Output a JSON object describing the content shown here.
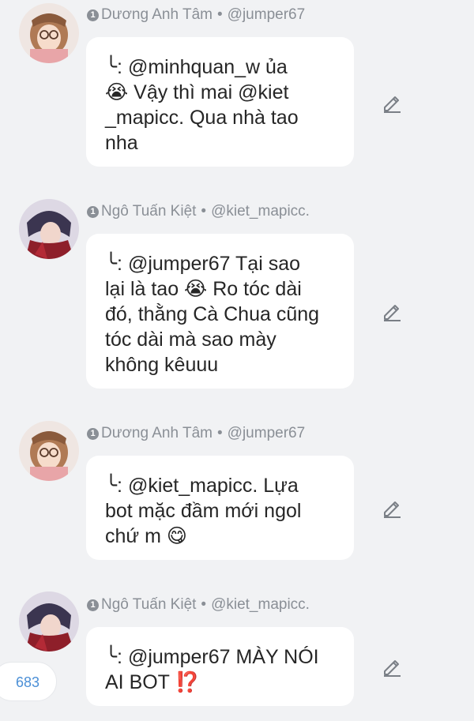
{
  "posts": [
    {
      "author": "Dương Anh Tâm",
      "handle": "@jumper67",
      "badge": "1",
      "avatar": "avatar-girl-glasses",
      "message": "╰: @minhquan_w ủa\n😭 Vậy thì mai @kiet\n_mapicc. Qua nhà tao\nnha"
    },
    {
      "author": "Ngô Tuấn Kiệt",
      "handle": "@kiet_mapicc.",
      "badge": "1",
      "avatar": "avatar-boy-red",
      "message": "╰: @jumper67 Tại sao\nlại là tao 😭 Ro tóc dài\nđó, thằng Cà Chua cũng\ntóc dài mà sao mày\nkhông kêuuu"
    },
    {
      "author": "Dương Anh Tâm",
      "handle": "@jumper67",
      "badge": "1",
      "avatar": "avatar-girl-glasses",
      "message": "╰: @kiet_mapicc. Lựa\nbot mặc đầm mới ngol\nchứ m 😋"
    },
    {
      "author": "Ngô Tuấn Kiệt",
      "handle": "@kiet_mapicc.",
      "badge": "1",
      "avatar": "avatar-boy-red",
      "message": "╰: @jumper67 MÀY NÓI\nAI BOT ⁉️"
    }
  ],
  "separator": "•",
  "counter": "683",
  "icons": {
    "edit": "pencil-icon"
  },
  "colors": {
    "background": "#f1f2f4",
    "bubble": "#ffffff",
    "meta_text": "#8a8f96",
    "counter_text": "#4b8fd6"
  }
}
